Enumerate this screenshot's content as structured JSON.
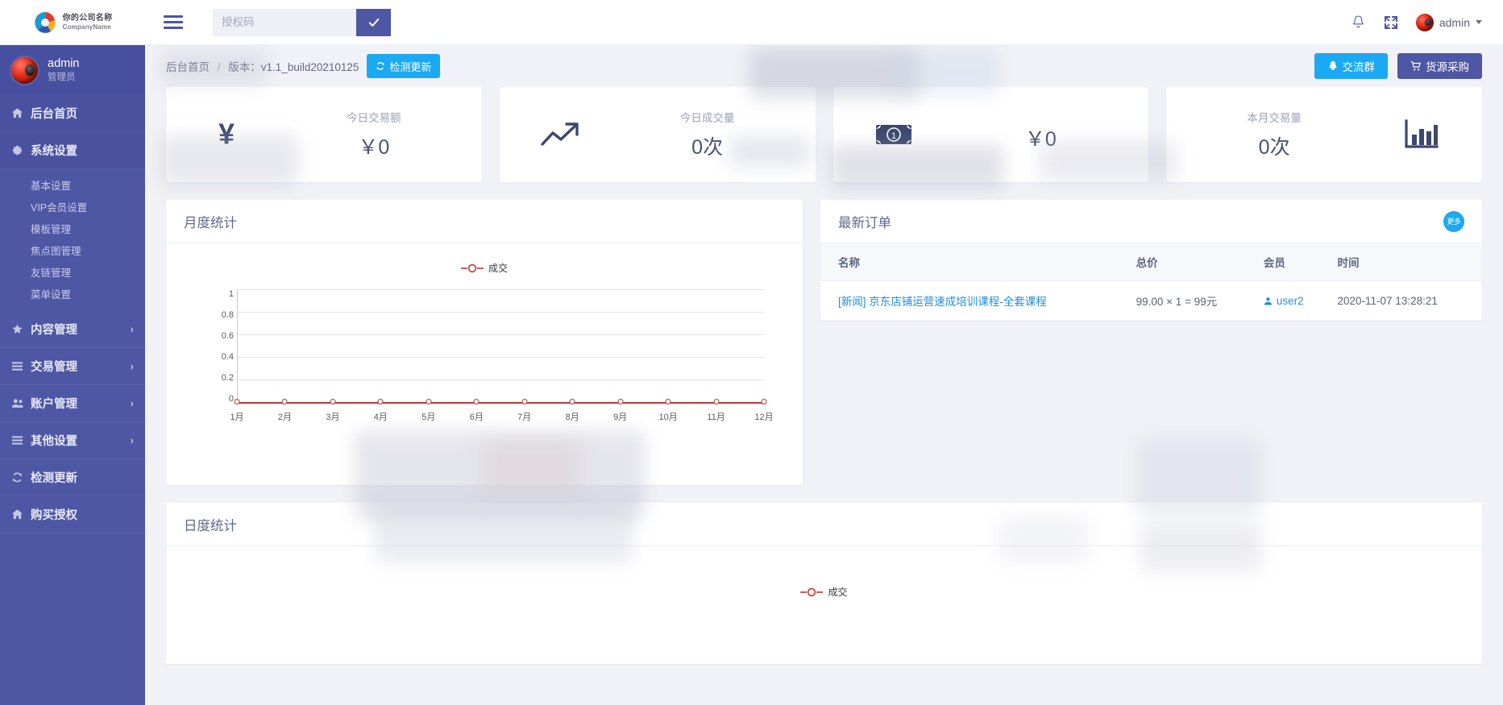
{
  "topbar": {
    "brand_cn": "你的公司名称",
    "brand_en": "CompanyName",
    "menu_icon": "hamburger-icon",
    "auth_placeholder": "授权码",
    "auth_value": "",
    "auth_submit_icon": "check-icon",
    "bell_icon": "bell-icon",
    "fullscreen_icon": "fullscreen-icon",
    "admin_label": "admin"
  },
  "sidebar": {
    "user_name": "admin",
    "user_role": "管理员",
    "items": [
      {
        "label": "后台首页",
        "icon": "home-icon",
        "active": true,
        "chevron": false
      },
      {
        "label": "系统设置",
        "icon": "gear-icon",
        "active": true,
        "chevron": false
      },
      {
        "label": "内容管理",
        "icon": "star-icon",
        "active": false,
        "chevron": true
      },
      {
        "label": "交易管理",
        "icon": "list-icon",
        "active": false,
        "chevron": true
      },
      {
        "label": "账户管理",
        "icon": "users-icon",
        "active": false,
        "chevron": true
      },
      {
        "label": "其他设置",
        "icon": "list-icon",
        "active": false,
        "chevron": true
      },
      {
        "label": "检测更新",
        "icon": "refresh-icon",
        "active": false,
        "chevron": false
      },
      {
        "label": "购买授权",
        "icon": "home-icon",
        "active": false,
        "chevron": false
      }
    ],
    "sub_items": [
      {
        "label": "基本设置"
      },
      {
        "label": "VIP会员设置"
      },
      {
        "label": "模板管理"
      },
      {
        "label": "焦点图管理"
      },
      {
        "label": "友链管理"
      },
      {
        "label": "菜单设置"
      }
    ]
  },
  "breadcrumb": {
    "home": "后台首页",
    "separator": "/",
    "version": "版本：v1.1_build20210125",
    "update_button": "检测更新",
    "update_icon": "refresh-icon"
  },
  "header_actions": [
    {
      "label": "交流群",
      "icon": "qq-icon",
      "color": "#1aa9f2"
    },
    {
      "label": "货源采购",
      "icon": "cart-icon",
      "color": "#4e57a3"
    }
  ],
  "stats": [
    {
      "label": "今日交易额",
      "value": "￥0",
      "icon": "yen-icon",
      "icon_side": "left"
    },
    {
      "label": "今日成交量",
      "value": "0次",
      "icon": "trend-up-icon",
      "icon_side": "left"
    },
    {
      "label": "",
      "value": "￥0",
      "icon": "banknote-icon",
      "icon_side": "left"
    },
    {
      "label": "本月交易量",
      "value": "0次",
      "icon": "bar-chart-icon",
      "icon_side": "left"
    }
  ],
  "monthly_panel": {
    "title": "月度统计"
  },
  "daily_panel": {
    "title": "日度统计"
  },
  "orders_panel": {
    "title": "最新订单",
    "more_label": "更多",
    "columns": [
      "名称",
      "总价",
      "会员",
      "时间"
    ],
    "rows": [
      {
        "name": "[新闻] 京东店铺运营速成培训课程-全套课程",
        "price": "99.00 × 1 = 99元",
        "user": "user2",
        "user_icon": "user-icon",
        "time": "2020-11-07 13:28:21"
      }
    ]
  },
  "chart_data": [
    {
      "type": "line",
      "title": "月度统计",
      "legend": [
        "成交"
      ],
      "legend_position": "top-center",
      "categories": [
        "1月",
        "2月",
        "3月",
        "4月",
        "5月",
        "6月",
        "7月",
        "8月",
        "9月",
        "10月",
        "11月",
        "12月"
      ],
      "series": [
        {
          "name": "成交",
          "values": [
            0,
            0,
            0,
            0,
            0,
            0,
            0,
            0,
            0,
            0,
            0,
            0
          ],
          "color": "#c23531"
        }
      ],
      "yticks": [
        "0",
        "0.2",
        "0.4",
        "0.6",
        "0.8",
        "1"
      ],
      "ylim": [
        0,
        1
      ],
      "xlabel": "",
      "ylabel": "",
      "grid": true
    },
    {
      "type": "line",
      "title": "日度统计",
      "legend": [
        "成交"
      ],
      "legend_position": "top-center",
      "categories": [],
      "series": [
        {
          "name": "成交",
          "values": [],
          "color": "#c23531"
        }
      ],
      "ylim": [
        0,
        1
      ],
      "grid": true
    }
  ]
}
